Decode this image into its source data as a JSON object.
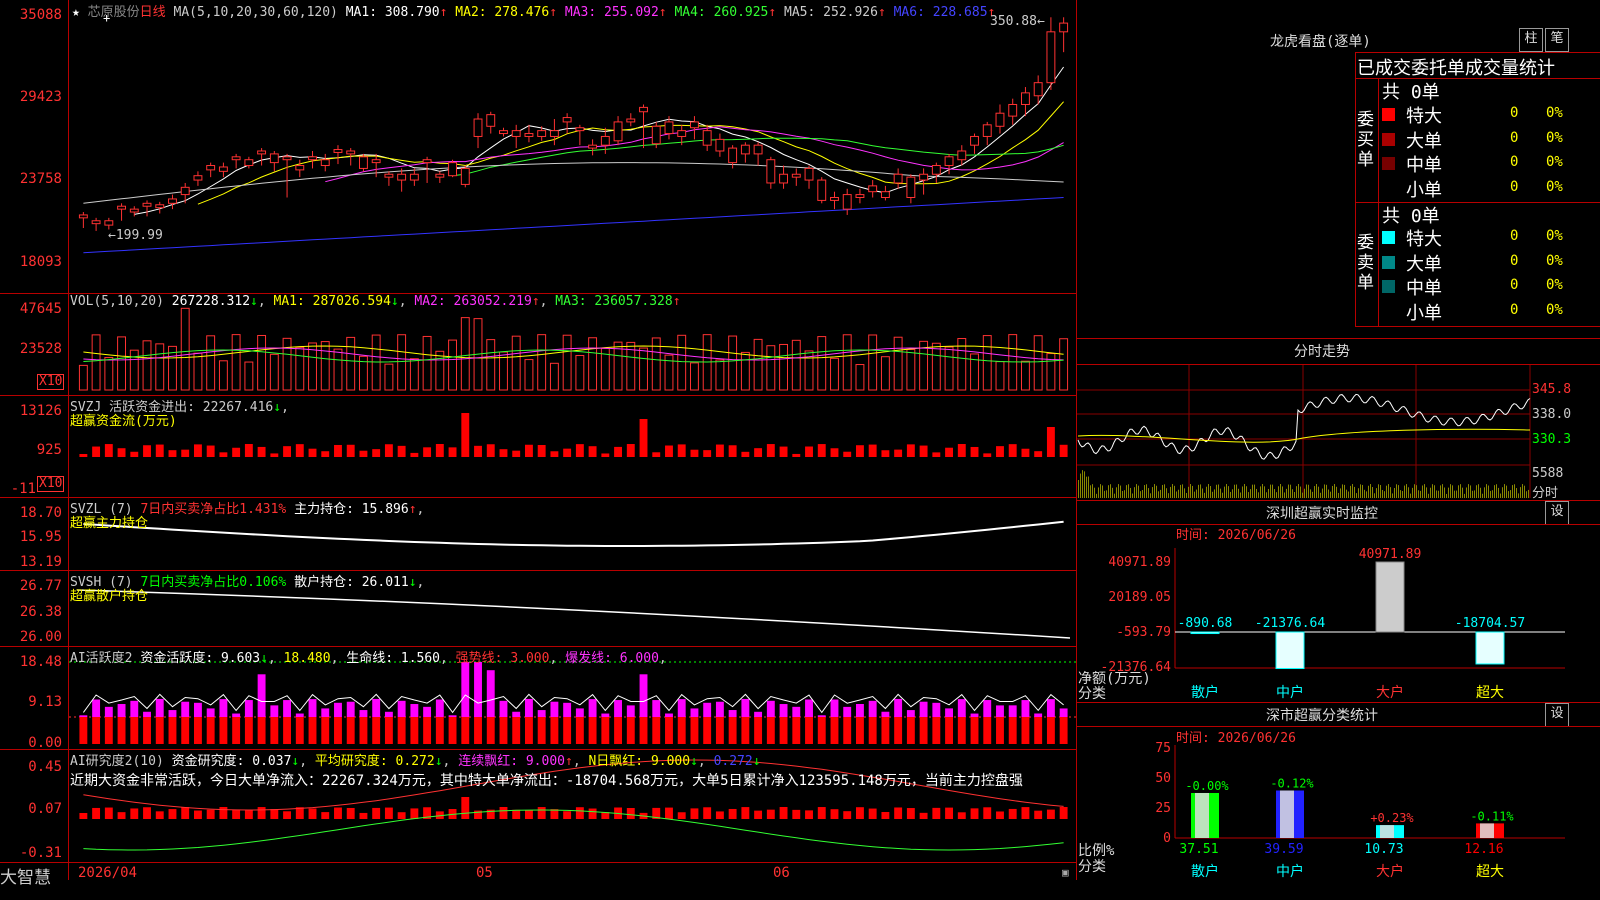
{
  "stock": {
    "name": "芯原股份",
    "period": "日线",
    "ma_params": "MA(5,10,20,30,60,120)",
    "ma": [
      {
        "label": "MA1: 308.790",
        "arrow": "↑",
        "color": "#ffffff"
      },
      {
        "label": "MA2: 278.476",
        "arrow": "↑",
        "color": "#ffff00"
      },
      {
        "label": "MA3: 255.092",
        "arrow": "↑",
        "color": "#ff33ff"
      },
      {
        "label": "MA4: 260.925",
        "arrow": "↑",
        "color": "#33ff33"
      },
      {
        "label": "MA5: 252.926",
        "arrow": "↑",
        "color": "#cccccc"
      },
      {
        "label": "MA6: 228.685",
        "arrow": "↑",
        "color": "#4444ff"
      }
    ],
    "high_mark": "350.88",
    "low_mark": "199.99"
  },
  "panels": {
    "price": {
      "yticks": [
        "35088",
        "29423",
        "23758",
        "18093"
      ]
    },
    "vol": {
      "title": "VOL(5,10,20)",
      "value": "267228.312",
      "ma1": "MA1: 287026.594",
      "ma2": "MA2: 263052.219",
      "ma3": "MA3: 236057.328",
      "yticks": [
        "47645",
        "23528"
      ],
      "unit": "X10"
    },
    "svzj": {
      "title": "SVZJ  活跃资金进出: 22267.416",
      "subtitle": "超赢资金流(万元)",
      "yticks": [
        "13126",
        "925",
        "-11"
      ],
      "unit": "X10"
    },
    "svzl": {
      "title": "SVZL (7)",
      "ratio": "7日内买卖净占比1.431%",
      "hold": "主力持仓: 15.896",
      "subtitle": "超赢主力持仓",
      "yticks": [
        "18.70",
        "15.95",
        "13.19"
      ]
    },
    "svsh": {
      "title": "SVSH (7)",
      "ratio": "7日内买卖净占比0.106%",
      "hold": "散户持仓: 26.011",
      "subtitle": "超赢散户持仓",
      "yticks": [
        "26.77",
        "26.38",
        "26.00"
      ]
    },
    "ai1": {
      "title": "AI活跃度2",
      "a": "资金活跃度: 9.603",
      "b": "18.480",
      "c": "生命线: 1.560",
      "d": "强势线: 3.000",
      "e": "爆发线: 6.000",
      "yticks": [
        "18.48",
        "9.13",
        "0.00"
      ]
    },
    "ai2": {
      "title": "AI研究度2(10)",
      "a": "资金研究度: 0.037",
      "b": "平均研究度: 0.272",
      "c": "连续飘红: 9.000",
      "d": "N日飘红: 9.000",
      "e": "0.272",
      "note": "近期大资金非常活跃，今日大单净流入：22267.324万元，其中特大单净流出：-18704.568万元，大单5日累计净入123595.148万元，当前主力控盘强",
      "yticks": [
        "0.45",
        "0.07",
        "-0.31"
      ]
    }
  },
  "xaxis": {
    "labels": [
      "2026/04",
      "05",
      "06"
    ]
  },
  "brand": "大智慧",
  "right": {
    "lhb": {
      "title": "龙虎看盘(逐单)",
      "btn1": "柱",
      "btn2": "笔",
      "heading": "已成交委托单成交量统计",
      "buy": {
        "side": "委买单",
        "total": "共 0单",
        "rows": [
          {
            "label": "特大",
            "count": "0",
            "pct": "0%",
            "color": "#ff0000"
          },
          {
            "label": "大单",
            "count": "0",
            "pct": "0%",
            "color": "#aa0000"
          },
          {
            "label": "中单",
            "count": "0",
            "pct": "0%",
            "color": "#770000"
          },
          {
            "label": "小单",
            "count": "0",
            "pct": "0%",
            "color": "#000000"
          }
        ]
      },
      "sell": {
        "side": "委卖单",
        "total": "共 0单",
        "rows": [
          {
            "label": "特大",
            "count": "0",
            "pct": "0%",
            "color": "#00ffff"
          },
          {
            "label": "大单",
            "count": "0",
            "pct": "0%",
            "color": "#008888"
          },
          {
            "label": "中单",
            "count": "0",
            "pct": "0%",
            "color": "#006666"
          },
          {
            "label": "小单",
            "count": "0",
            "pct": "0%",
            "color": "#000000"
          }
        ]
      }
    },
    "fenshi": {
      "title": "分时走势",
      "yticks": [
        "345.8",
        "338.0",
        "330.3"
      ],
      "vol_tick": "5588",
      "vol_unit": "分时"
    },
    "monitor": {
      "title": "深圳超赢实时监控",
      "btn": "设",
      "time": "时间: 2026/06/26",
      "yticks": [
        "40971.89",
        "20189.05",
        "-593.79",
        "-21376.64"
      ],
      "ylabel": "净额(万元)",
      "xlabel": "分类",
      "cats": [
        "散户",
        "中户",
        "大户",
        "超大"
      ],
      "values": [
        "-890.68",
        "-21376.64",
        "40971.89",
        "-18704.57"
      ]
    },
    "classify": {
      "title": "深市超赢分类统计",
      "btn": "设",
      "time": "时间: 2026/06/26",
      "yticks": [
        "75",
        "50",
        "25",
        "0"
      ],
      "ylabel": "比例%",
      "xlabel": "分类",
      "cats": [
        "散户",
        "中户",
        "大户",
        "超大"
      ],
      "values": [
        "37.51",
        "39.59",
        "10.73",
        "12.16"
      ],
      "changes": [
        "-0.00%",
        "-0.12%",
        "+0.23%",
        "-0.11%"
      ]
    }
  },
  "chart_data": {
    "type": "candlestick",
    "x": [
      "2026/04",
      "05",
      "06"
    ],
    "price_range": [
      18093,
      35088
    ],
    "candles": [
      [
        212,
        214,
        205,
        216,
        210
      ],
      [
        208,
        210,
        203,
        212,
        206
      ],
      [
        207,
        210,
        204,
        212,
        205
      ],
      [
        218,
        220,
        210,
        222,
        212
      ],
      [
        216,
        218,
        213,
        220,
        215
      ],
      [
        220,
        222,
        213,
        224,
        214
      ],
      [
        219,
        221,
        215,
        223,
        216
      ],
      [
        222,
        225,
        218,
        228,
        220
      ],
      [
        228,
        233,
        222,
        236,
        225
      ],
      [
        238,
        241,
        234,
        244,
        236
      ],
      [
        245,
        248,
        240,
        250,
        242
      ],
      [
        244,
        247,
        240,
        250,
        243
      ],
      [
        252,
        254,
        246,
        256,
        248
      ],
      [
        248,
        252,
        246,
        254,
        250
      ],
      [
        256,
        258,
        248,
        260,
        250
      ],
      [
        250,
        256,
        244,
        258,
        246
      ],
      [
        252,
        254,
        226,
        256,
        230
      ],
      [
        245,
        248,
        240,
        252,
        244
      ],
      [
        252,
        254,
        246,
        258,
        250
      ],
      [
        248,
        252,
        244,
        256,
        249
      ],
      [
        257,
        259,
        249,
        262,
        250
      ],
      [
        256,
        258,
        248,
        260,
        252
      ],
      [
        246,
        254,
        244,
        256,
        252
      ],
      [
        250,
        252,
        240,
        256,
        241
      ],
      [
        240,
        242,
        234,
        244,
        238
      ],
      [
        238,
        242,
        230,
        246,
        240
      ],
      [
        238,
        242,
        234,
        246,
        241
      ],
      [
        250,
        252,
        236,
        254,
        246
      ],
      [
        240,
        242,
        236,
        244,
        241
      ],
      [
        241,
        250,
        240,
        252,
        248
      ],
      [
        235,
        246,
        233,
        248,
        244
      ],
      [
        268,
        280,
        260,
        284,
        262
      ],
      [
        275,
        283,
        270,
        285,
        278
      ],
      [
        270,
        272,
        268,
        274,
        271
      ],
      [
        268,
        272,
        260,
        276,
        263
      ],
      [
        268,
        270,
        264,
        276,
        268
      ],
      [
        268,
        272,
        265,
        275,
        267
      ],
      [
        268,
        272,
        262,
        280,
        268
      ],
      [
        278,
        281,
        270,
        284,
        272
      ],
      [
        272,
        274,
        262,
        276,
        265
      ],
      [
        260,
        262,
        255,
        266,
        258
      ],
      [
        262,
        268,
        256,
        274,
        265
      ],
      [
        265,
        278,
        262,
        282,
        275
      ],
      [
        278,
        280,
        275,
        284,
        278
      ],
      [
        285,
        288,
        260,
        290,
        265
      ],
      [
        263,
        275,
        260,
        278,
        270
      ],
      [
        270,
        278,
        266,
        282,
        272
      ],
      [
        268,
        272,
        262,
        276,
        268
      ],
      [
        274,
        278,
        266,
        282,
        272
      ],
      [
        262,
        272,
        258,
        276,
        268
      ],
      [
        258,
        266,
        254,
        270,
        258
      ],
      [
        250,
        260,
        246,
        262,
        256
      ],
      [
        256,
        262,
        250,
        264,
        252
      ],
      [
        256,
        262,
        248,
        264,
        252
      ],
      [
        236,
        252,
        232,
        254,
        248
      ],
      [
        236,
        242,
        232,
        248,
        240
      ],
      [
        240,
        242,
        234,
        246,
        238
      ],
      [
        238,
        246,
        232,
        248,
        242
      ],
      [
        224,
        238,
        222,
        240,
        234
      ],
      [
        224,
        226,
        218,
        230,
        222
      ],
      [
        218,
        228,
        214,
        232,
        224
      ],
      [
        226,
        228,
        222,
        232,
        224
      ],
      [
        230,
        234,
        226,
        238,
        230
      ],
      [
        226,
        230,
        224,
        234,
        228
      ],
      [
        236,
        242,
        232,
        246,
        238
      ],
      [
        226,
        240,
        222,
        242,
        238
      ],
      [
        238,
        242,
        228,
        246,
        232
      ],
      [
        242,
        248,
        236,
        250,
        244
      ],
      [
        248,
        254,
        242,
        256,
        252
      ],
      [
        252,
        258,
        248,
        262,
        256
      ],
      [
        262,
        268,
        256,
        270,
        265
      ],
      [
        268,
        276,
        262,
        278,
        272
      ],
      [
        275,
        284,
        270,
        290,
        282
      ],
      [
        282,
        290,
        276,
        294,
        286
      ],
      [
        290,
        298,
        282,
        302,
        295
      ],
      [
        296,
        305,
        290,
        310,
        300
      ],
      [
        305,
        340,
        300,
        350,
        338
      ],
      [
        340,
        346,
        326,
        350,
        330
      ]
    ]
  }
}
